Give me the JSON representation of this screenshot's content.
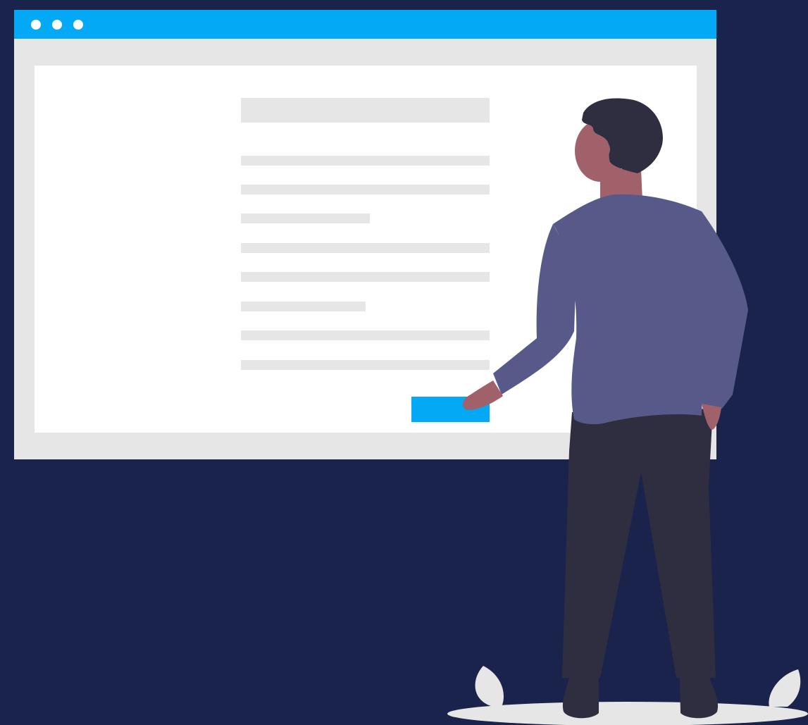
{
  "colors": {
    "background": "#1a234b",
    "window_titlebar": "#03a9f4",
    "window_frame": "#e6e6e6",
    "window_content": "#ffffff",
    "placeholder_line": "#e6e6e6",
    "button": "#03a9f4",
    "hair": "#2f2e41",
    "skin": "#a0616a",
    "shirt": "#575a89",
    "pants": "#2f2e41",
    "shoes": "#2f2e41",
    "ground": "#e6e6e6",
    "leaf": "#e6e6e6",
    "window_dot": "#ffffff"
  },
  "browser_window": {
    "titlebar_dots": [
      "dot-1",
      "dot-2",
      "dot-3"
    ],
    "content_lines": [
      "heading",
      "line",
      "line",
      "short-line",
      "line",
      "line",
      "short-line",
      "line",
      "line"
    ],
    "has_button": true
  },
  "figure": {
    "description_icon": "person-icon"
  },
  "decor": {
    "leaves": [
      "leaf-left",
      "leaf-right"
    ]
  }
}
